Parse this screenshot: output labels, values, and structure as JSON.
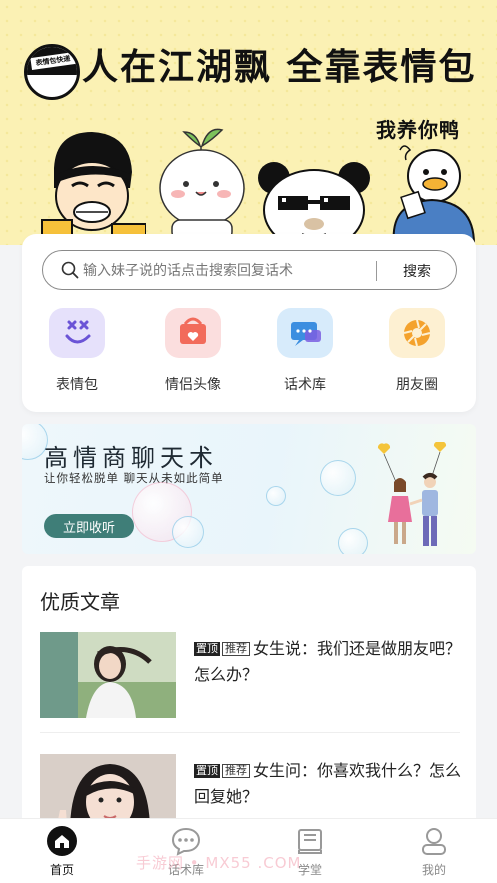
{
  "banner": {
    "title": "人在江湖飘 全靠表情包",
    "subtitle": "我养你鸭",
    "logo_tag": "表情包快递"
  },
  "search": {
    "placeholder": "输入妹子说的话点击搜索回复话术",
    "button_label": "搜索"
  },
  "categories": [
    {
      "label": "表情包",
      "icon": "smile-icon",
      "color": "#6b54d6"
    },
    {
      "label": "情侣头像",
      "icon": "couple-frame-icon",
      "color": "#f26b5b"
    },
    {
      "label": "话术库",
      "icon": "chat-bubble-icon",
      "color": "#3c8ee0"
    },
    {
      "label": "朋友圈",
      "icon": "aperture-icon",
      "color": "#f4a22d"
    }
  ],
  "promo": {
    "title": "高情商聊天术",
    "subtitle": "让你轻松脱单  聊天从未如此简单",
    "button_label": "立即收听"
  },
  "articles": {
    "section_title": "优质文章",
    "items": [
      {
        "tag_top": "置顶",
        "tag_rec": "推荐",
        "title": "女生说：我们还是做朋友吧？怎么办？"
      },
      {
        "tag_top": "置顶",
        "tag_rec": "推荐",
        "title": "女生问：你喜欢我什么？怎么回复她？"
      }
    ]
  },
  "tabbar": [
    {
      "label": "首页",
      "icon": "home-icon",
      "active": true
    },
    {
      "label": "话术库",
      "icon": "chat-icon",
      "active": false
    },
    {
      "label": "学堂",
      "icon": "book-icon",
      "active": false
    },
    {
      "label": "我的",
      "icon": "user-icon",
      "active": false
    }
  ],
  "watermark": "手游网 • MX55 .COM",
  "colors": {
    "banner_bg": "#fbf1b4",
    "promo_button": "#3f7e78",
    "page_bg": "#f3f4f6"
  }
}
